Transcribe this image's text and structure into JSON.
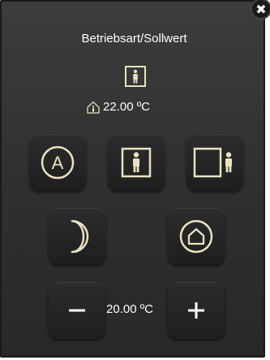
{
  "popup": {
    "title": "Betriebsart/Sollwert",
    "current_mode_icon": "person-in-door-icon",
    "actual_temperature": "22.00 ºC",
    "setpoint_temperature": "20.00 ºC",
    "close_label": "✖"
  },
  "buttons": {
    "auto": {
      "label": "A",
      "icon": "auto-mode-icon"
    },
    "comfort": {
      "icon": "comfort-person-icon"
    },
    "standby": {
      "icon": "standby-person-icon"
    },
    "night": {
      "icon": "moon-icon"
    },
    "frost": {
      "icon": "house-protection-icon"
    },
    "decrease": {
      "label": "−",
      "icon": "minus-icon"
    },
    "increase": {
      "label": "+",
      "icon": "plus-icon"
    }
  },
  "colors": {
    "accent": "#e9e3c0",
    "text": "#ffffff",
    "background": "#333333"
  }
}
